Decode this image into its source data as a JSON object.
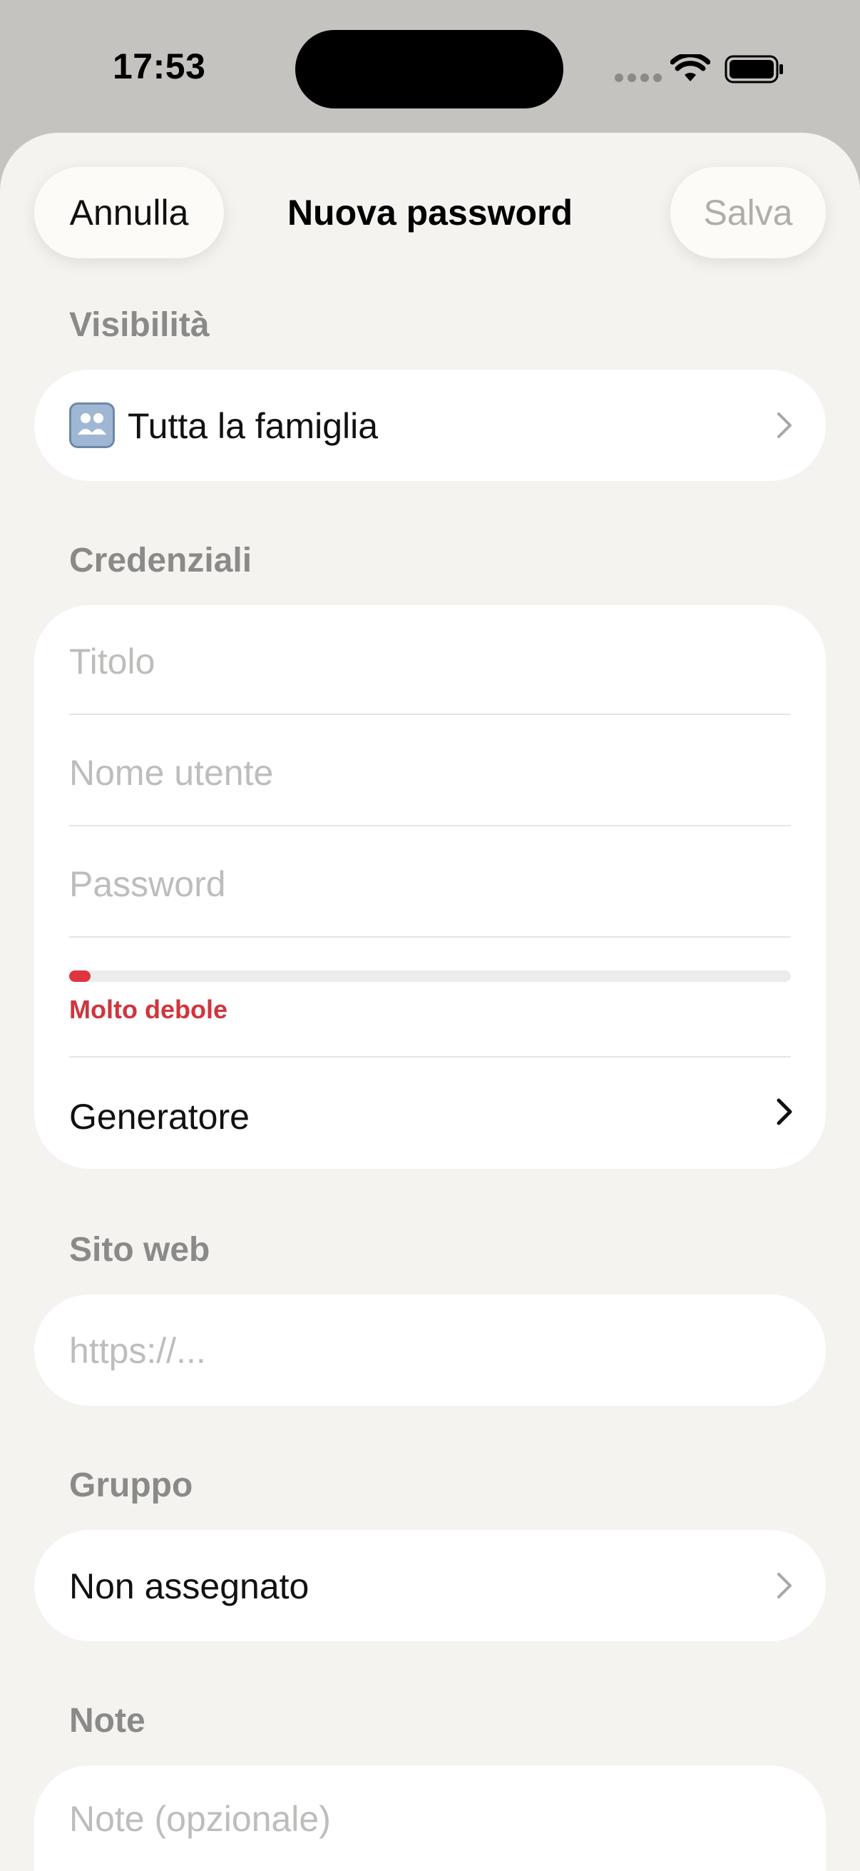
{
  "status_bar": {
    "time": "17:53",
    "icons": [
      "cellular-signal-icon",
      "wifi-icon",
      "battery-icon"
    ]
  },
  "nav": {
    "cancel_label": "Annulla",
    "title": "Nuova password",
    "save_label": "Salva"
  },
  "visibility": {
    "header": "Visibilità",
    "value": "Tutta la famiglia",
    "icon": "family-icon"
  },
  "credentials": {
    "header": "Credenziali",
    "title_placeholder": "Titolo",
    "username_placeholder": "Nome utente",
    "password_placeholder": "Password",
    "strength_label": "Molto debole",
    "strength_level": 0.02,
    "generator_label": "Generatore"
  },
  "website": {
    "header": "Sito web",
    "placeholder": "https://..."
  },
  "group": {
    "header": "Gruppo",
    "value": "Non assegnato"
  },
  "notes": {
    "header": "Note",
    "placeholder": "Note (opzionale)"
  },
  "colors": {
    "sheet_background": "#f4f3f0",
    "card_background": "#ffffff",
    "strength_color": "#e0343e",
    "section_header": "#8a8a88"
  }
}
